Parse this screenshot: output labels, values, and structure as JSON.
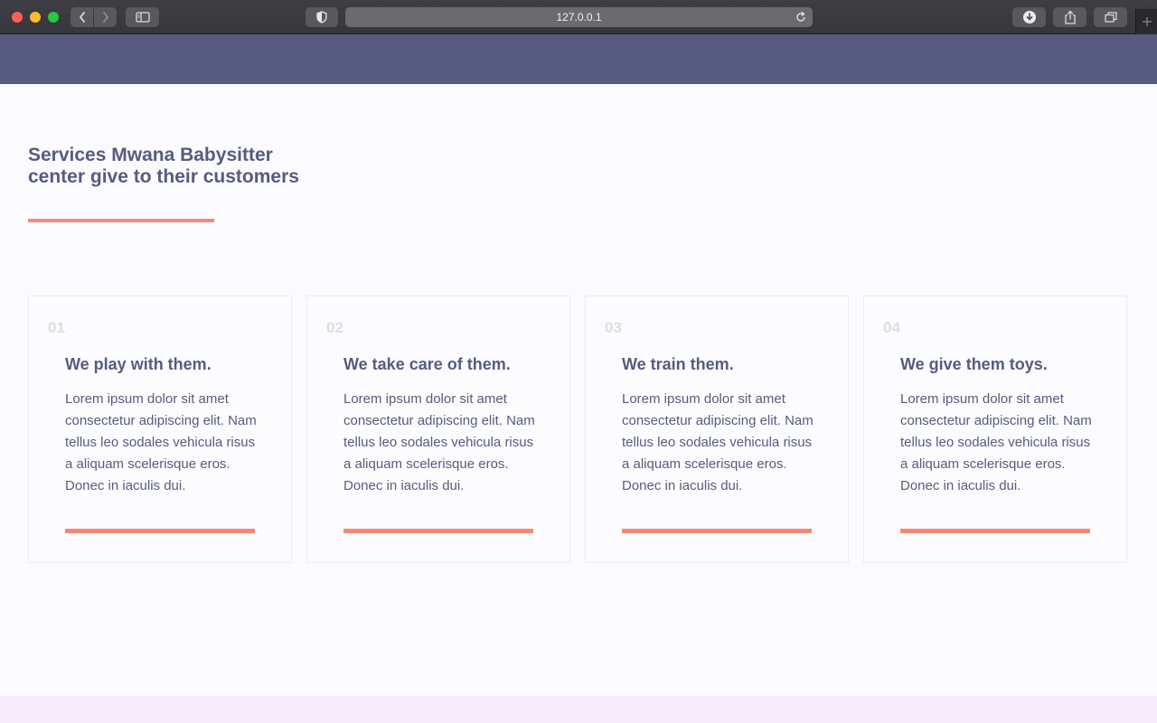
{
  "browser": {
    "address": "127.0.0.1"
  },
  "section": {
    "title": "Services Mwana Babysitter center give to their customers"
  },
  "cards": [
    {
      "number": "01",
      "title": "We play with them.",
      "text": "Lorem ipsum dolor sit amet consectetur adipiscing elit. Nam tellus leo sodales vehicula risus a aliquam scelerisque eros. Donec in iaculis dui."
    },
    {
      "number": "02",
      "title": "We take care of them.",
      "text": "Lorem ipsum dolor sit amet consectetur adipiscing elit. Nam tellus leo sodales vehicula risus a aliquam scelerisque eros. Donec in iaculis dui."
    },
    {
      "number": "03",
      "title": "We train them.",
      "text": "Lorem ipsum dolor sit amet consectetur adipiscing elit. Nam tellus leo sodales vehicula risus a aliquam scelerisque eros. Donec in iaculis dui."
    },
    {
      "number": "04",
      "title": "We give them toys.",
      "text": "Lorem ipsum dolor sit amet consectetur adipiscing elit. Nam tellus leo sodales vehicula risus a aliquam scelerisque eros. Donec in iaculis dui."
    }
  ],
  "colors": {
    "header": "#575b80",
    "accent": "#f48a74",
    "text": "#575b80",
    "footer": "#f5ebfa"
  },
  "icons": {
    "back": "chevron-left-icon",
    "forward": "chevron-right-icon",
    "sidebar": "sidebar-icon",
    "privacy": "shield-icon",
    "reload": "reload-icon",
    "downloads": "download-icon",
    "share": "share-icon",
    "tabs": "tabs-icon",
    "new_tab": "plus-icon"
  }
}
